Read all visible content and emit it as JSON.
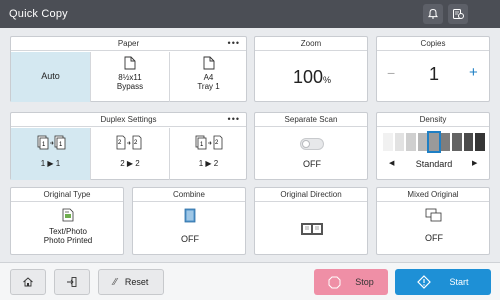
{
  "header": {
    "title": "Quick Copy",
    "bell_icon": "bell-icon",
    "user_icon": "account-icon"
  },
  "paper": {
    "title": "Paper",
    "more": "•••",
    "options": [
      {
        "label": "Auto",
        "line2": "",
        "selected": true
      },
      {
        "label": "8½x11",
        "line2": "Bypass",
        "selected": false
      },
      {
        "label": "A4",
        "line2": "Tray 1",
        "selected": false
      }
    ]
  },
  "zoom": {
    "title": "Zoom",
    "value": "100",
    "unit": "%"
  },
  "copies": {
    "title": "Copies",
    "minus": "−",
    "value": "1",
    "plus": "+"
  },
  "duplex": {
    "title": "Duplex Settings",
    "more": "•••",
    "options": [
      {
        "label": "1 ▶ 1",
        "selected": true
      },
      {
        "label": "2 ▶ 2",
        "selected": false
      },
      {
        "label": "1 ▶ 2",
        "selected": false
      }
    ]
  },
  "separate_scan": {
    "title": "Separate Scan",
    "value": "OFF"
  },
  "density": {
    "title": "Density",
    "value": "Standard",
    "left": "◀",
    "right": "▶",
    "level_index": 4,
    "levels": 9
  },
  "original_type": {
    "title": "Original Type",
    "line1": "Text/Photo",
    "line2": "Photo Printed"
  },
  "combine": {
    "title": "Combine",
    "value": "OFF"
  },
  "original_direction": {
    "title": "Original Direction"
  },
  "mixed_original": {
    "title": "Mixed Original",
    "value": "OFF"
  },
  "footer": {
    "reset": "Reset",
    "stop": "Stop",
    "start": "Start"
  },
  "colors": {
    "selected": "#d4e8f1",
    "stop": "#ef8fa6",
    "start": "#1e90d6",
    "density_selected": "#1e7fc4"
  }
}
